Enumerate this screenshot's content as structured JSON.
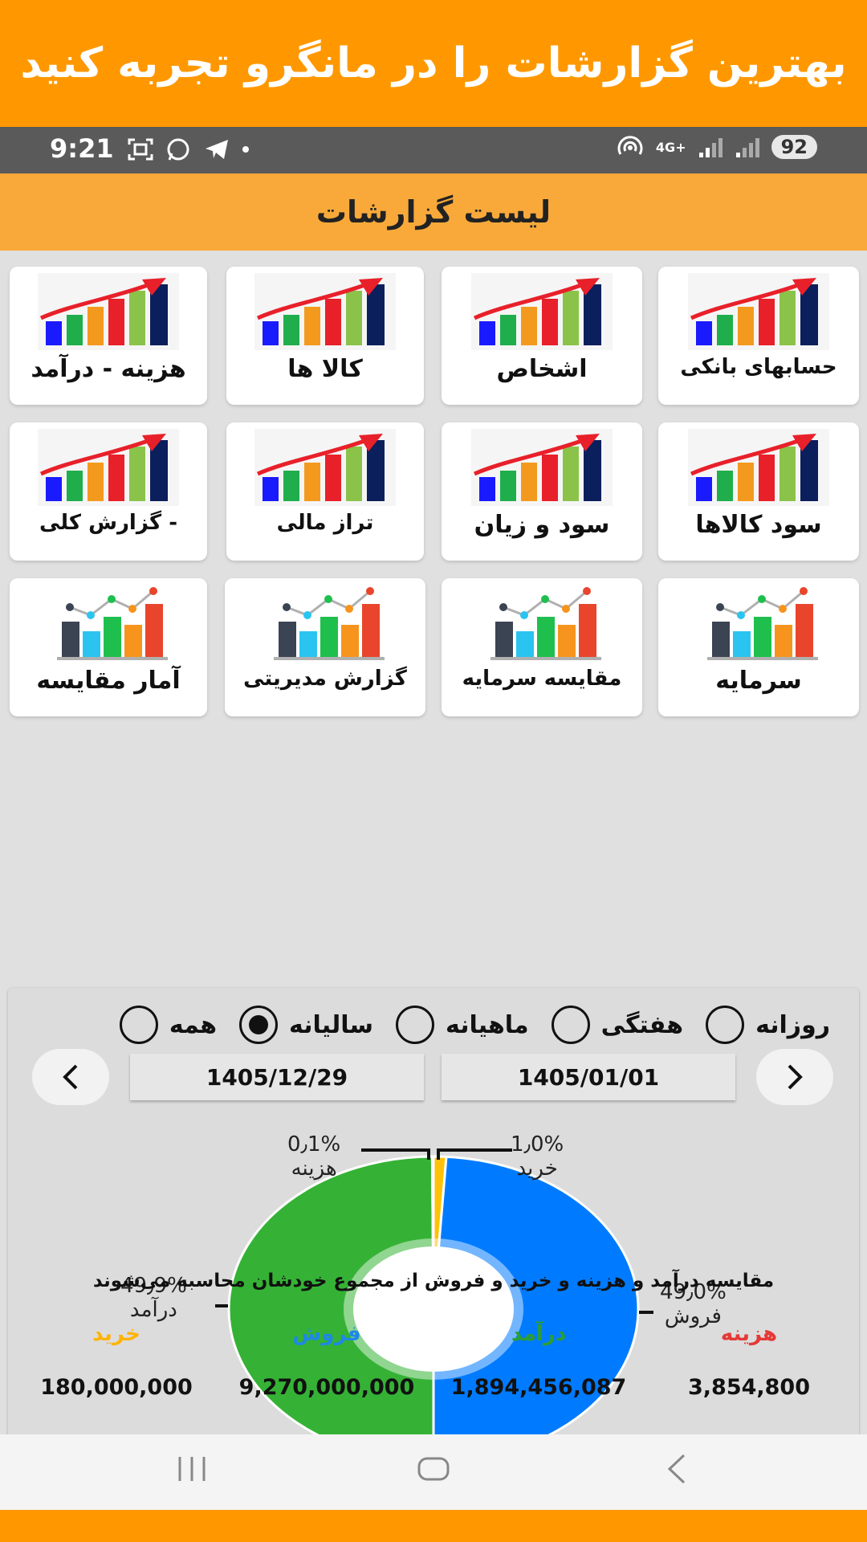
{
  "promo": {
    "text": "بهترین گزارشات را در مانگرو تجربه کنید"
  },
  "status_bar": {
    "time": "9:21",
    "network": "4G+",
    "battery": "92"
  },
  "app_bar": {
    "title": "لیست گزارشات"
  },
  "report_tiles": [
    {
      "label": "حسابهای بانکی",
      "icon": "bar-chart-rising-icon"
    },
    {
      "label": "اشخاص",
      "icon": "bar-chart-rising-icon"
    },
    {
      "label": "کالا ها",
      "icon": "bar-chart-rising-icon"
    },
    {
      "label": "هزینه - درآمد",
      "icon": "bar-chart-rising-icon"
    },
    {
      "label": "سود کالاها",
      "icon": "bar-chart-rising-icon"
    },
    {
      "label": "سود و زیان",
      "icon": "bar-chart-rising-icon"
    },
    {
      "label": "تراز مالی",
      "icon": "bar-chart-rising-icon"
    },
    {
      "label": "گزارش کلی -",
      "icon": "bar-chart-rising-icon"
    },
    {
      "label": "سرمایه",
      "icon": "bar-line-chart-icon"
    },
    {
      "label": "مقایسه سرمایه",
      "icon": "bar-line-chart-icon"
    },
    {
      "label": "گزارش مدیریتی",
      "icon": "bar-line-chart-icon"
    },
    {
      "label": "آمار مقایسه",
      "icon": "bar-line-chart-icon"
    }
  ],
  "period_filter": {
    "options": [
      "روزانه",
      "هفتگی",
      "ماهیانه",
      "سالیانه",
      "همه"
    ],
    "selected": "سالیانه"
  },
  "date_range": {
    "from": "1405/01/01",
    "to": "1405/12/29"
  },
  "chart_data": {
    "type": "pie",
    "donut": true,
    "slices": [
      {
        "label": "خرید",
        "value": 1.0,
        "percent_text": "1٫0%",
        "color": "#ffc107"
      },
      {
        "label": "فروش",
        "value": 49.0,
        "percent_text": "49٫0%",
        "color": "#007bff"
      },
      {
        "label": "درآمد",
        "value": 49.9,
        "percent_text": "49٫9%",
        "color": "#35b235"
      },
      {
        "label": "هزینه",
        "value": 0.1,
        "percent_text": "0٫1%",
        "color": "#e53935"
      }
    ]
  },
  "summary": {
    "title": "مقایسه درآمد و هزینه و خرید و فروش از مجموع خودشان محاسبه می‌شوند",
    "items": [
      {
        "name": "هزینه",
        "value": "3,854,800",
        "color": "#e53935"
      },
      {
        "name": "درآمد",
        "value": "1,894,456,087",
        "color": "#2e9e2e"
      },
      {
        "name": "فروش",
        "value": "9,270,000,000",
        "color": "#1e88e5"
      },
      {
        "name": "خرید",
        "value": "180,000,000",
        "color": "#ffb300"
      }
    ]
  }
}
